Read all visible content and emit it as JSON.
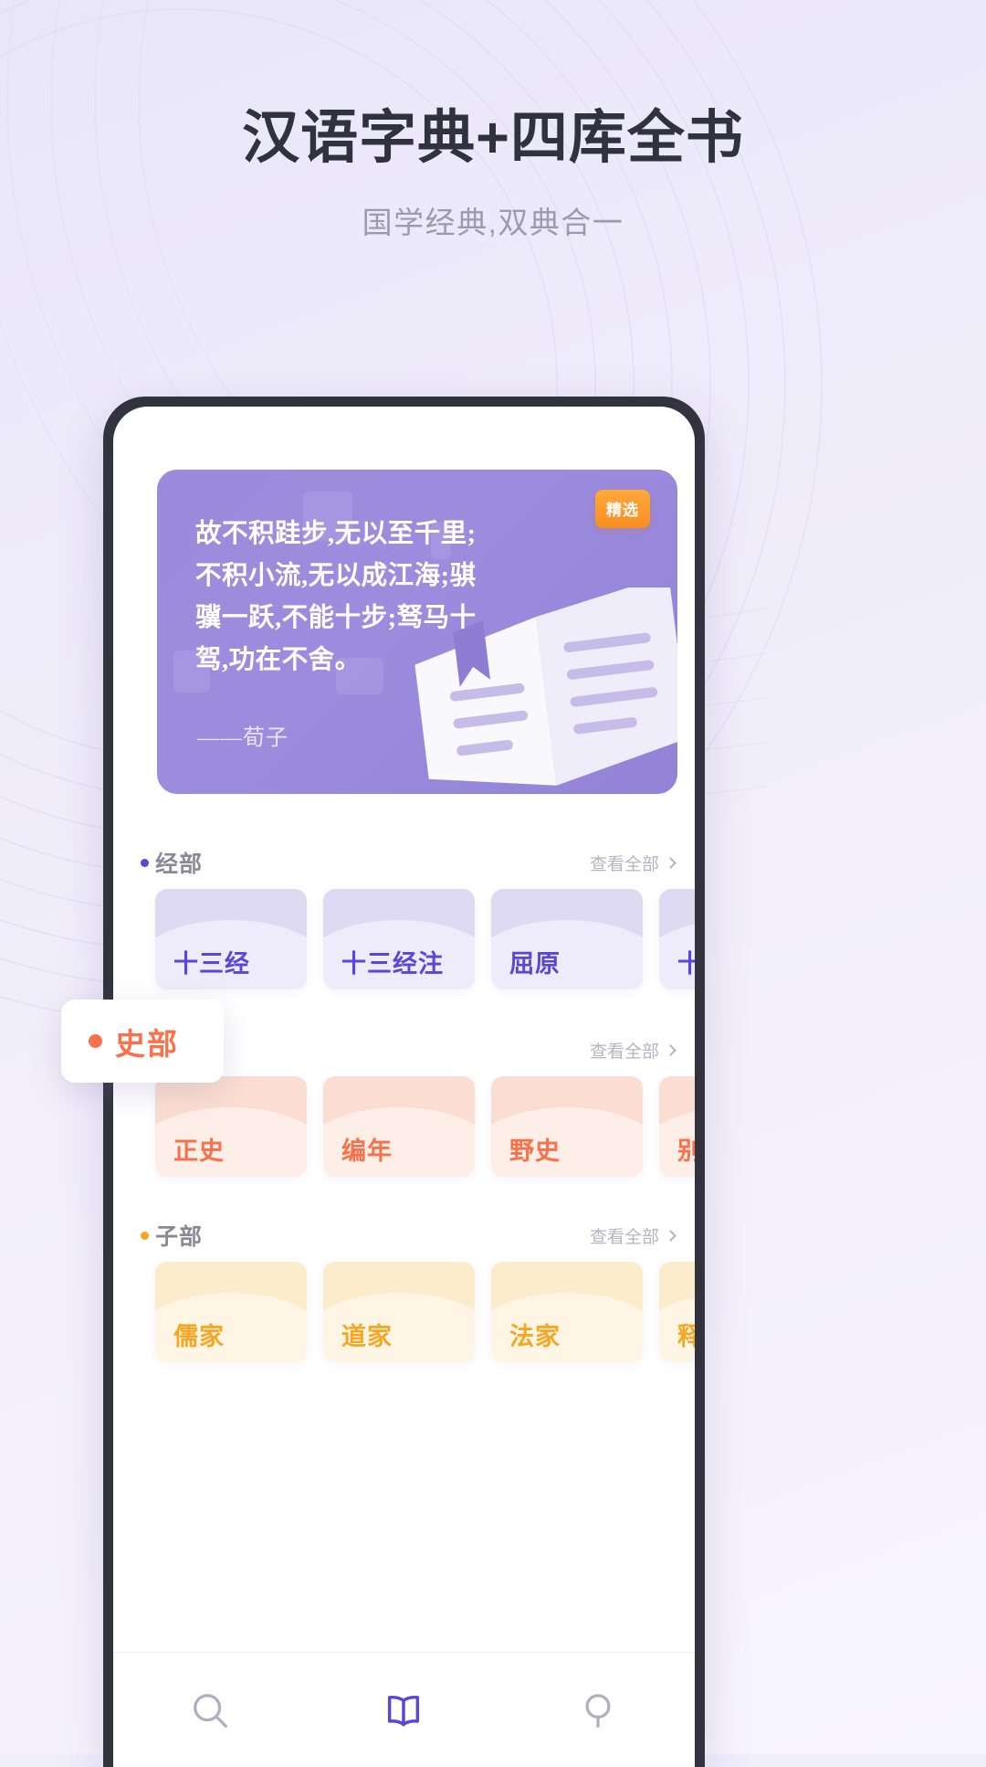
{
  "header": {
    "title": "汉语字典+四库全书",
    "subtitle": "国学经典,双典合一"
  },
  "phone": {
    "quote_card": {
      "badge": "精选",
      "text": "故不积跬步,无以至千里;不积小流,无以成江海;骐骥一跃,不能十步;驽马十驾,功在不舍。",
      "author": "——荀子"
    },
    "sections": [
      {
        "title": "经部",
        "more_label": "查看全部",
        "theme": "purple",
        "dot_color": "#5b46d6",
        "title_color": "#8a8897",
        "books": [
          "十三经",
          "十三经注",
          "屈原",
          "十"
        ]
      },
      {
        "title": "史部",
        "more_label": "查看全部",
        "theme": "orange",
        "dot_color": "#f9714a",
        "title_color": "#f9714a",
        "books": [
          "正史",
          "编年",
          "野史",
          "别"
        ]
      },
      {
        "title": "子部",
        "more_label": "查看全部",
        "theme": "amber",
        "dot_color": "#f5a623",
        "title_color": "#8a8897",
        "books": [
          "儒家",
          "道家",
          "法家",
          "释"
        ]
      }
    ],
    "floating_card": {
      "label": "史部"
    },
    "bottom_nav": [
      {
        "icon": "search-icon",
        "active": false
      },
      {
        "icon": "book-icon",
        "active": true
      },
      {
        "icon": "mirror-icon",
        "active": false
      }
    ]
  },
  "colors": {
    "accent_purple": "#5b46d6",
    "accent_orange": "#f9714a",
    "accent_amber": "#f5a623",
    "card_purple": "#9b8bdc",
    "title_dark": "#32323f",
    "subtitle_gray": "#9d9bab"
  }
}
